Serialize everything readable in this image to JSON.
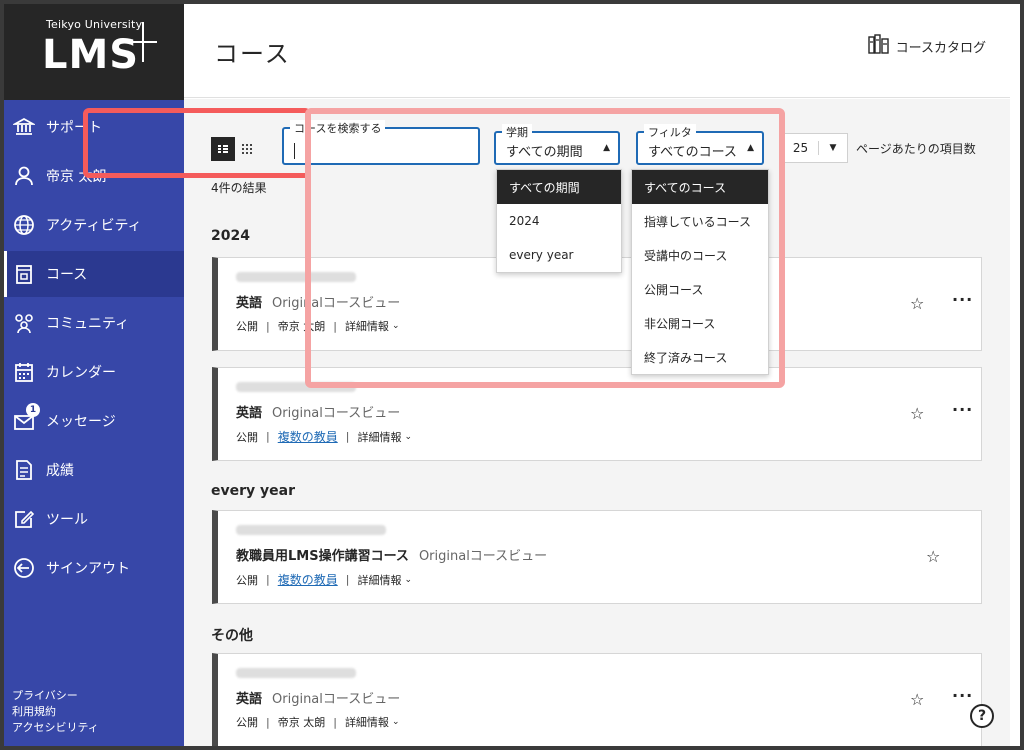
{
  "brand": {
    "university": "Teikyo University",
    "product": "LMS"
  },
  "sidebar": {
    "items": [
      {
        "label": "サポート",
        "icon": "bank-icon"
      },
      {
        "label": "帝京 太朗",
        "icon": "user-icon"
      },
      {
        "label": "アクティビティ",
        "icon": "globe-icon"
      },
      {
        "label": "コース",
        "icon": "course-icon"
      },
      {
        "label": "コミュニティ",
        "icon": "community-icon"
      },
      {
        "label": "カレンダー",
        "icon": "calendar-icon"
      },
      {
        "label": "メッセージ",
        "icon": "mail-icon",
        "badge": "1"
      },
      {
        "label": "成績",
        "icon": "grades-icon"
      },
      {
        "label": "ツール",
        "icon": "tools-icon"
      },
      {
        "label": "サインアウト",
        "icon": "signout-icon"
      }
    ],
    "footer": [
      "プライバシー",
      "利用規約",
      "アクセシビリティ"
    ]
  },
  "header": {
    "title": "コース",
    "catalog_label": "コースカタログ"
  },
  "toolbar": {
    "search": {
      "label": "コースを検索する",
      "value": ""
    },
    "term": {
      "label": "学期",
      "value": "すべての期間"
    },
    "filter": {
      "label": "フィルタ",
      "value": "すべてのコース"
    },
    "per_page": {
      "value": "25",
      "label": "ページあたりの項目数"
    }
  },
  "result_count": "4件の結果",
  "groups": [
    "2024",
    "every year",
    "その他"
  ],
  "courses": [
    {
      "title": "英語",
      "view": "Originalコースビュー",
      "status": "公開",
      "instructor": "帝京 太朗",
      "details": "詳細情報"
    },
    {
      "title": "英語",
      "view": "Originalコースビュー",
      "status": "公開",
      "instructor": "複数の教員",
      "details": "詳細情報"
    },
    {
      "title": "教職員用LMS操作講習コース",
      "view": "Originalコースビュー",
      "status": "公開",
      "instructor": "複数の教員",
      "details": "詳細情報"
    },
    {
      "title": "英語",
      "view": "Originalコースビュー",
      "status": "公開",
      "instructor": "帝京 太朗",
      "details": "詳細情報"
    }
  ],
  "term_dropdown": [
    "すべての期間",
    "2024",
    "every year"
  ],
  "filter_dropdown": [
    "すべてのコース",
    "指導しているコース",
    "受講中のコース",
    "公開コース",
    "非公開コース",
    "終了済みコース"
  ],
  "colors": {
    "sidebar": "#3747a8",
    "accent": "#1f6ab5",
    "highlight_red": "#f45b5b",
    "highlight_pink": "#f5a3a3"
  }
}
